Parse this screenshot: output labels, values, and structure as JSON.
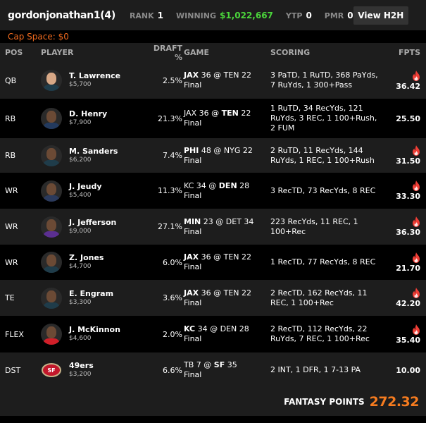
{
  "header": {
    "username": "gordonjonathan1",
    "entries": "(4)",
    "rank_label": "RANK",
    "rank": "1",
    "winning_label": "WINNING",
    "winning": "$1,022,667",
    "ytp_label": "YTP",
    "ytp": "0",
    "pmr_label": "PMR",
    "pmr": "0",
    "h2h_button": "View H2H",
    "cap_space": "Cap Space: $0"
  },
  "columns": {
    "pos": "POS",
    "player": "PLAYER",
    "draft": "DRAFT %",
    "game": "GAME",
    "scoring": "SCORING",
    "fpts": "FPTS"
  },
  "colors": {
    "winning": "#4bd63b",
    "cap_space": "#f06a1e",
    "fire": "#ef3e36",
    "total": "#f57b1f"
  },
  "rows": [
    {
      "pos": "QB",
      "name": "T. Lawrence",
      "salary": "$5,700",
      "draft": "2.5%",
      "away": "JAX",
      "away_score": "36",
      "home": "TEN",
      "home_score": "22",
      "winner": "away",
      "status": "Final",
      "scoring": "3 PaTD, 1 RuTD, 368 PaYds, 7 RuYds, 1 300+Pass",
      "fpts": "36.42",
      "hot": true,
      "icon": "fire-icon"
    },
    {
      "pos": "RB",
      "name": "D. Henry",
      "salary": "$7,900",
      "draft": "21.3%",
      "away": "JAX",
      "away_score": "36",
      "home": "TEN",
      "home_score": "22",
      "winner": "home",
      "status": "Final",
      "scoring": "1 RuTD, 34 RecYds, 121 RuYds, 3 REC, 1 100+Rush, 2 FUM",
      "fpts": "25.50",
      "hot": false
    },
    {
      "pos": "RB",
      "name": "M. Sanders",
      "salary": "$6,200",
      "draft": "7.4%",
      "away": "PHI",
      "away_score": "48",
      "home": "NYG",
      "home_score": "22",
      "winner": "away",
      "status": "Final",
      "scoring": "2 RuTD, 11 RecYds, 144 RuYds, 1 REC, 1 100+Rush",
      "fpts": "31.50",
      "hot": true,
      "icon": "fire-icon"
    },
    {
      "pos": "WR",
      "name": "J. Jeudy",
      "salary": "$5,400",
      "draft": "11.3%",
      "away": "KC",
      "away_score": "34",
      "home": "DEN",
      "home_score": "28",
      "winner": "home",
      "status": "Final",
      "scoring": "3 RecTD, 73 RecYds, 8 REC",
      "fpts": "33.30",
      "hot": true,
      "icon": "fire-icon"
    },
    {
      "pos": "WR",
      "name": "J. Jefferson",
      "salary": "$9,000",
      "draft": "27.1%",
      "away": "MIN",
      "away_score": "23",
      "home": "DET",
      "home_score": "34",
      "winner": "away",
      "status": "Final",
      "scoring": "223 RecYds, 11 REC, 1 100+Rec",
      "fpts": "36.30",
      "hot": true,
      "icon": "fire-icon"
    },
    {
      "pos": "WR",
      "name": "Z. Jones",
      "salary": "$4,700",
      "draft": "6.0%",
      "away": "JAX",
      "away_score": "36",
      "home": "TEN",
      "home_score": "22",
      "winner": "away",
      "status": "Final",
      "scoring": "1 RecTD, 77 RecYds, 8 REC",
      "fpts": "21.70",
      "hot": true,
      "icon": "fire-icon"
    },
    {
      "pos": "TE",
      "name": "E. Engram",
      "salary": "$3,300",
      "draft": "3.6%",
      "away": "JAX",
      "away_score": "36",
      "home": "TEN",
      "home_score": "22",
      "winner": "away",
      "status": "Final",
      "scoring": "2 RecTD, 162 RecYds, 11 REC, 1 100+Rec",
      "fpts": "42.20",
      "hot": true,
      "icon": "fire-icon"
    },
    {
      "pos": "FLEX",
      "name": "J. McKinnon",
      "salary": "$4,600",
      "draft": "2.0%",
      "away": "KC",
      "away_score": "34",
      "home": "DEN",
      "home_score": "28",
      "winner": "away",
      "status": "Final",
      "scoring": "2 RecTD, 112 RecYds, 22 RuYds, 7 REC, 1 100+Rec",
      "fpts": "35.40",
      "hot": true,
      "icon": "fire-icon"
    },
    {
      "pos": "DST",
      "name": "49ers",
      "salary": "$3,200",
      "draft": "6.6%",
      "away": "TB",
      "away_score": "7",
      "home": "SF",
      "home_score": "35",
      "winner": "home",
      "status": "Final",
      "scoring": "2 INT, 1 DFR, 1 7-13 PA",
      "fpts": "10.00",
      "hot": false
    }
  ],
  "footer": {
    "label": "FANTASY POINTS",
    "total": "272.32"
  }
}
